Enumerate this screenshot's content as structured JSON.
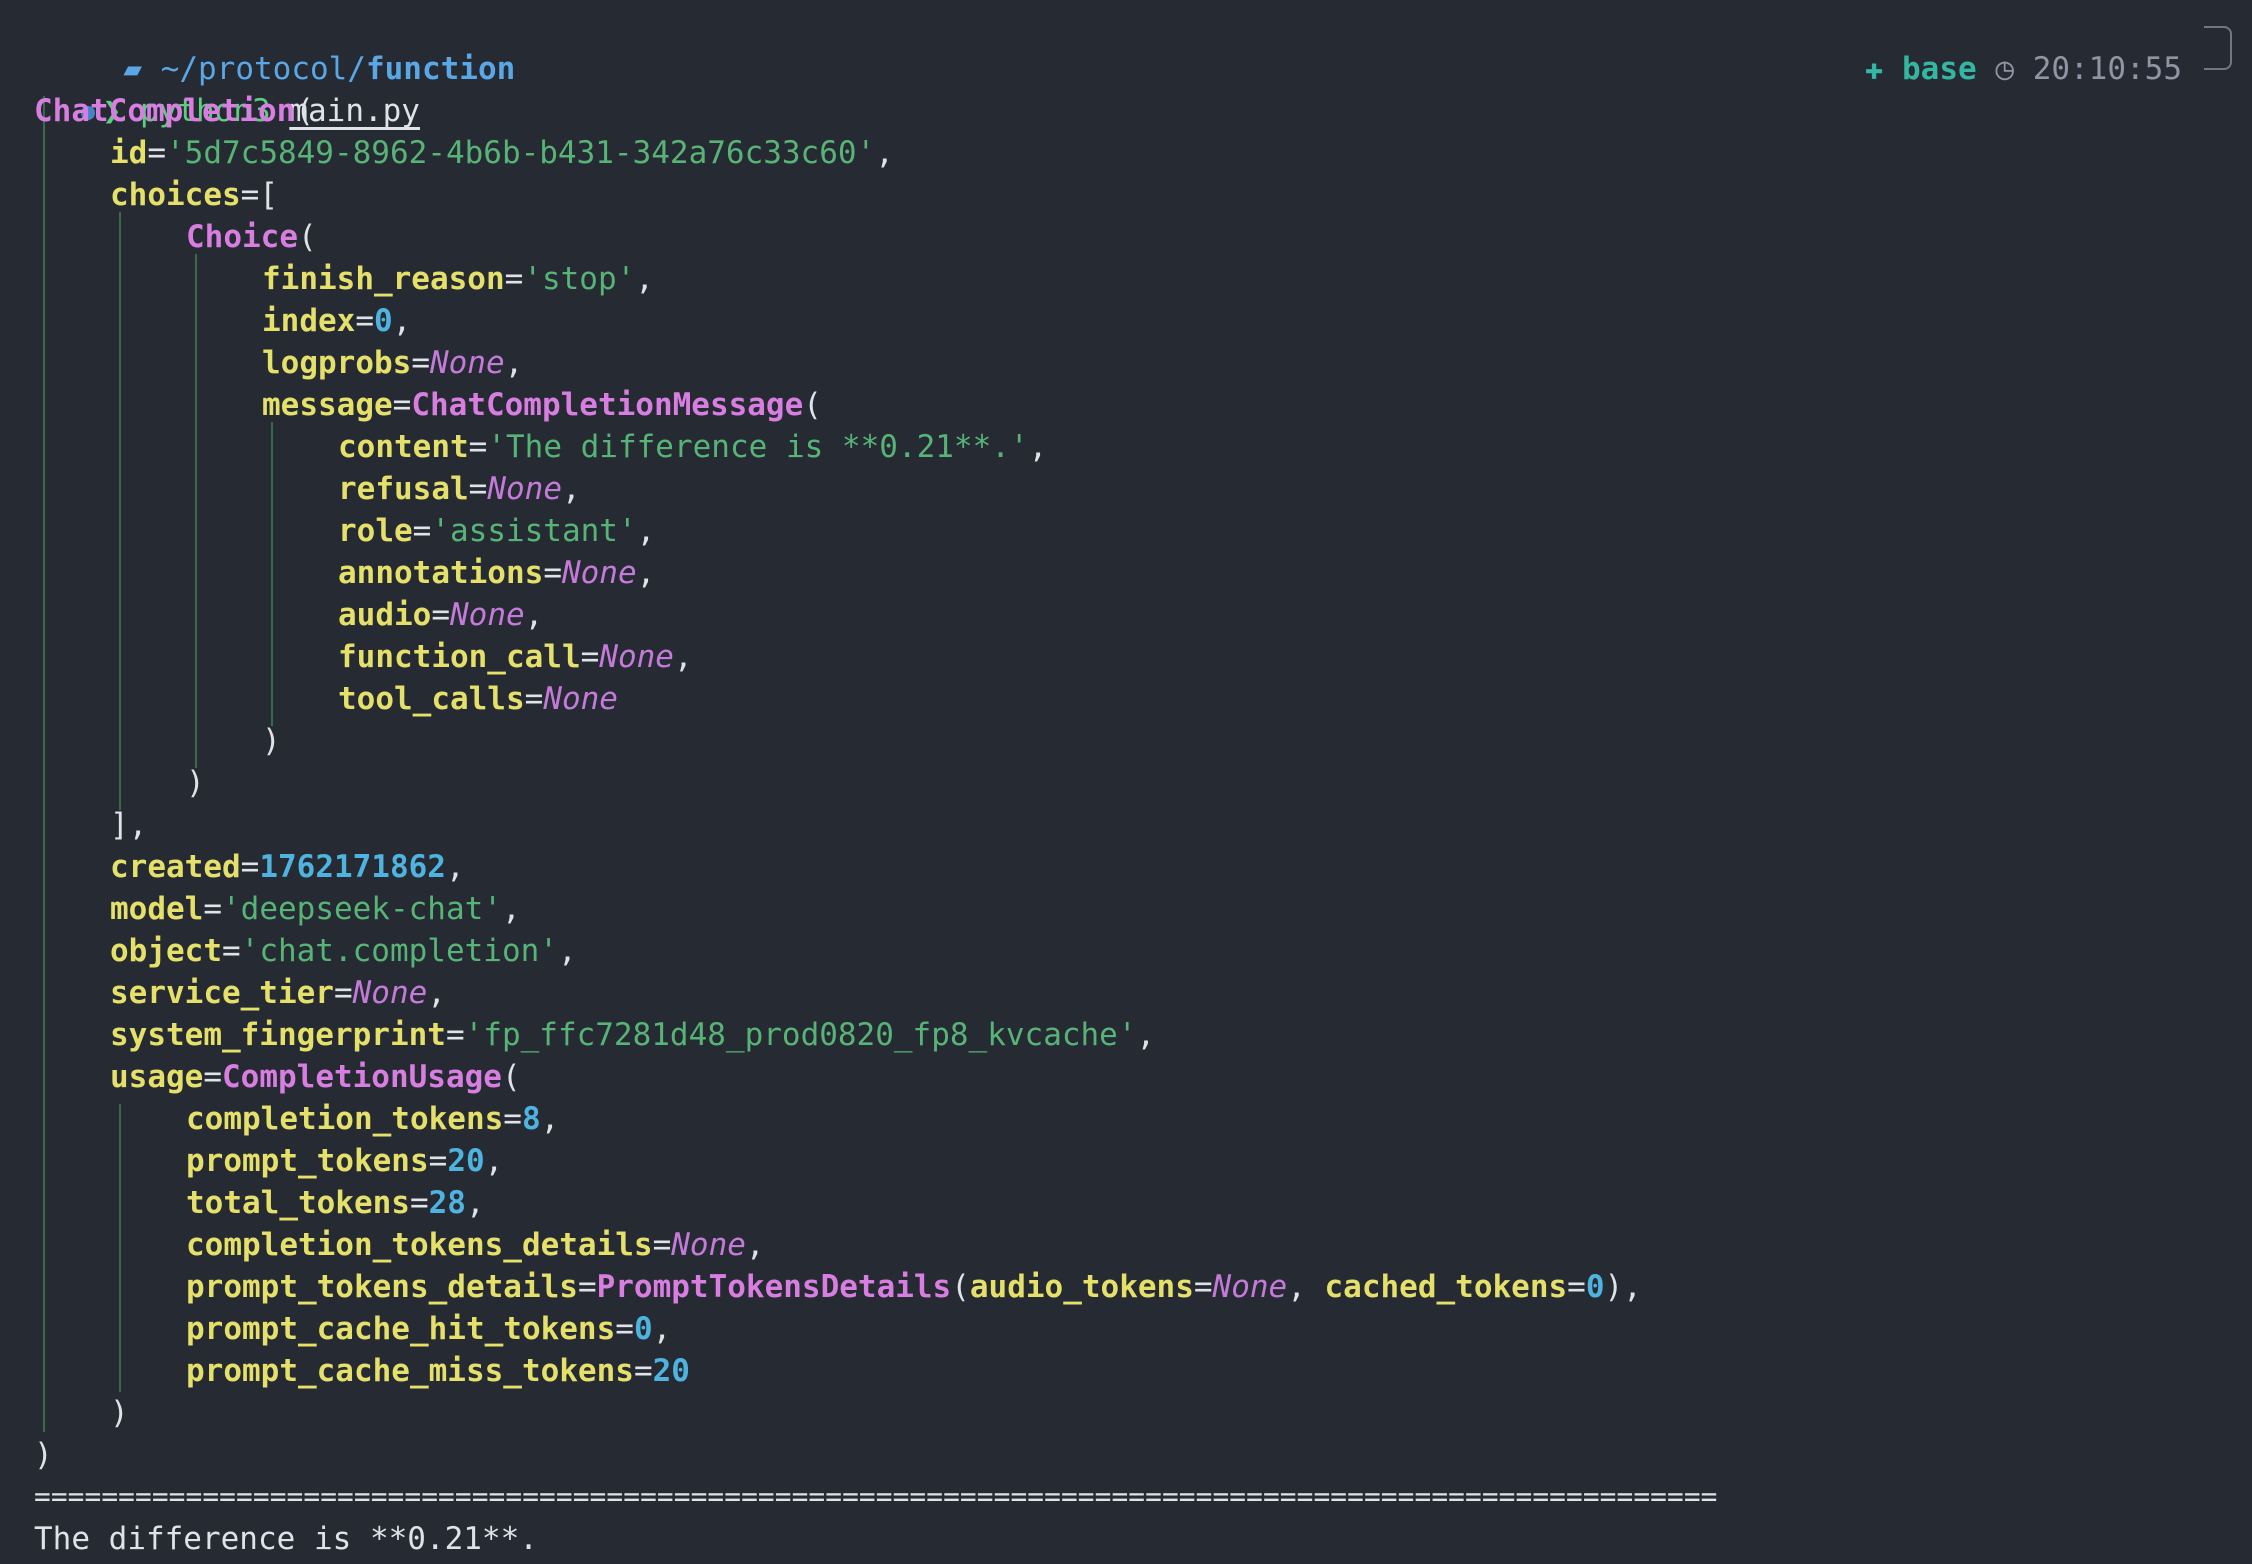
{
  "prompt": {
    "apple_icon": "apple-icon",
    "folder_icon": "folder-icon",
    "path_prefix": "~/protocol/",
    "path_current": "function",
    "env_icon": "conda-env-icon",
    "env_name": "base",
    "clock_icon": "clock-icon",
    "time": "20:10:55",
    "arrow": "❯",
    "command": "python3",
    "argument": "main.py"
  },
  "output": {
    "root_class": "ChatCompletion",
    "id_key": "id",
    "id_value": "'5d7c5849-8962-4b6b-b431-342a76c33c60'",
    "choices_key": "choices",
    "choice_class": "Choice",
    "finish_reason_key": "finish_reason",
    "finish_reason_value": "'stop'",
    "index_key": "index",
    "index_value": "0",
    "logprobs_key": "logprobs",
    "none": "None",
    "message_key": "message",
    "message_class": "ChatCompletionMessage",
    "content_key": "content",
    "content_value": "'The difference is **0.21**.'",
    "refusal_key": "refusal",
    "role_key": "role",
    "role_value": "'assistant'",
    "annotations_key": "annotations",
    "audio_key": "audio",
    "function_call_key": "function_call",
    "tool_calls_key": "tool_calls",
    "created_key": "created",
    "created_value": "1762171862",
    "model_key": "model",
    "model_value": "'deepseek-chat'",
    "object_key": "object",
    "object_value": "'chat.completion'",
    "service_tier_key": "service_tier",
    "system_fingerprint_key": "system_fingerprint",
    "system_fingerprint_value": "'fp_ffc7281d48_prod0820_fp8_kvcache'",
    "usage_key": "usage",
    "usage_class": "CompletionUsage",
    "completion_tokens_key": "completion_tokens",
    "completion_tokens_value": "8",
    "prompt_tokens_key": "prompt_tokens",
    "prompt_tokens_value": "20",
    "total_tokens_key": "total_tokens",
    "total_tokens_value": "28",
    "completion_tokens_details_key": "completion_tokens_details",
    "prompt_tokens_details_key": "prompt_tokens_details",
    "prompt_tokens_details_class": "PromptTokensDetails",
    "audio_tokens_key": "audio_tokens",
    "cached_tokens_key": "cached_tokens",
    "cached_tokens_value": "0",
    "prompt_cache_hit_tokens_key": "prompt_cache_hit_tokens",
    "prompt_cache_hit_tokens_value": "0",
    "prompt_cache_miss_tokens_key": "prompt_cache_miss_tokens",
    "prompt_cache_miss_tokens_value": "20",
    "separator": "====================================================================================================",
    "final_text": "The difference is **0.21**."
  },
  "colors": {
    "background": "#262a33",
    "key": "#e5e06a",
    "class": "#d77ee0",
    "string": "#57b476",
    "number": "#4fb3e0",
    "none": "#c47ad8",
    "prompt_path": "#5aa7e6",
    "prompt_arrow": "#5ccf7f",
    "env": "#35b6a3"
  }
}
